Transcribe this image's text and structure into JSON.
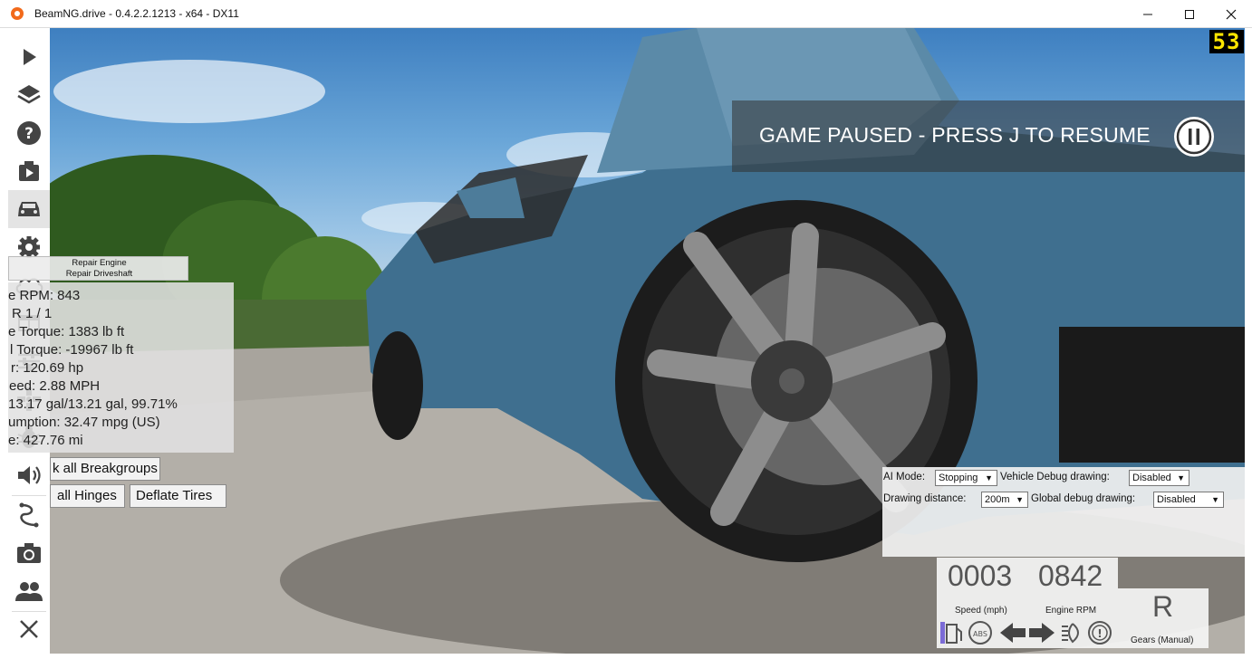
{
  "window": {
    "title": "BeamNG.drive - 0.4.2.2.1213 - x64 - DX11"
  },
  "sidebar": {
    "items": [
      {
        "icon": "play-icon"
      },
      {
        "icon": "layers-icon"
      },
      {
        "icon": "help-icon"
      },
      {
        "icon": "scenario-icon"
      },
      {
        "icon": "car-icon",
        "active": true
      },
      {
        "icon": "gear-icon"
      },
      {
        "icon": "cloud-icon"
      },
      {
        "icon": "dashboard-icon"
      },
      {
        "icon": "sliders-icon"
      },
      {
        "icon": "controls-icon"
      },
      {
        "icon": "bug-icon"
      },
      {
        "icon": "sound-icon"
      },
      {
        "icon": "track-icon"
      },
      {
        "icon": "camera-icon"
      },
      {
        "icon": "users-icon"
      },
      {
        "icon": "close-icon"
      }
    ]
  },
  "pause": {
    "text": "GAME PAUSED - PRESS J TO RESUME"
  },
  "fps": "53",
  "repair": {
    "engine": "Repair Engine",
    "driveshaft": "Repair Driveshaft"
  },
  "stats": [
    "e RPM: 843",
    "R 1 / 1",
    "e Torque: 1383 lb ft",
    "l Torque: -19967 lb ft",
    "r: 120.69 hp",
    "eed: 2.88 MPH",
    "13.17 gal/13.21 gal, 99.71%",
    "umption: 32.47 mpg (US)",
    "e: 427.76 mi"
  ],
  "buttons": {
    "breakgroups": "k all Breakgroups",
    "hinges": "all Hinges",
    "deflate": "Deflate Tires"
  },
  "ai": {
    "mode_label": "AI Mode:",
    "mode_value": "Stopping",
    "vehicle_debug_label": "Vehicle Debug drawing:",
    "vehicle_debug_value": "Disabled",
    "distance_label": "Drawing distance:",
    "distance_value": "200m",
    "global_debug_label": "Global debug drawing:",
    "global_debug_value": "Disabled"
  },
  "dashboard": {
    "speed": "0003",
    "rpm": "0842",
    "speed_label": "Speed (mph)",
    "rpm_label": "Engine RPM",
    "gear": "R",
    "gear_label": "Gears (Manual)"
  },
  "colors": {
    "car_blue": "#3f6f8f",
    "pause_banner": "#323232",
    "fps_yellow": "#ffe600"
  }
}
